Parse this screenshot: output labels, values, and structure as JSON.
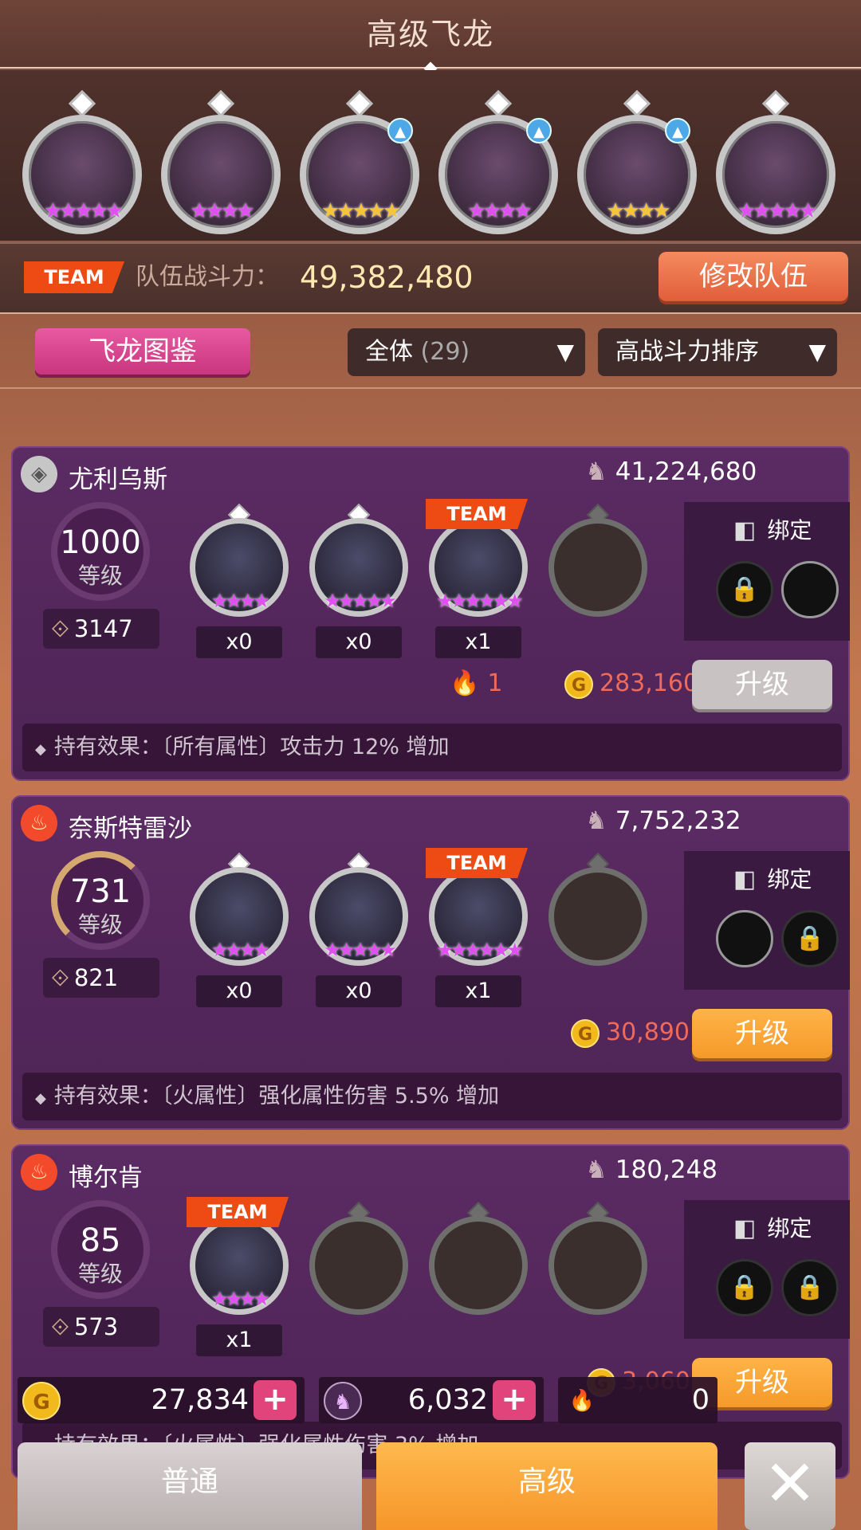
{
  "header": {
    "title": "高级飞龙"
  },
  "team_strip": {
    "slots": [
      {
        "name": "slot-1",
        "stars": "★★★★★",
        "star_color": "purple",
        "upgrade": false
      },
      {
        "name": "slot-2",
        "stars": "★★★★",
        "star_color": "purple",
        "upgrade": false
      },
      {
        "name": "slot-3",
        "stars": "★★★★★",
        "star_color": "gold",
        "upgrade": true
      },
      {
        "name": "slot-4",
        "stars": "★★★★",
        "star_color": "purple",
        "upgrade": true
      },
      {
        "name": "slot-5",
        "stars": "★★★★",
        "star_color": "gold",
        "upgrade": true
      },
      {
        "name": "slot-6",
        "stars": "★★★★★",
        "star_color": "purple",
        "upgrade": false
      }
    ],
    "upgrade_icon": "▲"
  },
  "power_bar": {
    "team_tag": "TEAM",
    "label": "队伍战斗力：",
    "value": "49,382,480",
    "modify_button": "修改队伍"
  },
  "filters": {
    "codex_button": "飞龙图鉴",
    "category": "全体",
    "category_count": "(29)",
    "sort": "高战斗力排序",
    "arrow": "▼"
  },
  "cards": [
    {
      "element": "neutral",
      "element_icon": "◈",
      "name": "尤利乌斯",
      "power": "41,224,680",
      "level": "1000",
      "level_label": "等级",
      "rank": "3147",
      "slots": [
        {
          "count": "x0",
          "stars": "★★★★",
          "team": false,
          "empty": false
        },
        {
          "count": "x0",
          "stars": "★★★★★",
          "team": false,
          "empty": false
        },
        {
          "count": "x1",
          "stars": "★★★★★★",
          "team": true,
          "empty": false
        },
        {
          "count": "",
          "stars": "",
          "team": false,
          "empty": true
        }
      ],
      "team_label": "TEAM",
      "bind_label": "绑定",
      "flame_cost": "1",
      "coin_cost": "283,160",
      "upgrade": "升级",
      "effect": "持有效果：〔所有属性〕攻击力 12% 增加"
    },
    {
      "element": "fire",
      "element_icon": "♨",
      "name": "奈斯特雷沙",
      "power": "7,752,232",
      "level": "731",
      "level_label": "等级",
      "rank": "821",
      "slots": [
        {
          "count": "x0",
          "stars": "★★★★",
          "team": false,
          "empty": false
        },
        {
          "count": "x0",
          "stars": "★★★★★",
          "team": false,
          "empty": false
        },
        {
          "count": "x1",
          "stars": "★★★★★★",
          "team": true,
          "empty": false
        },
        {
          "count": "",
          "stars": "",
          "team": false,
          "empty": true
        }
      ],
      "team_label": "TEAM",
      "bind_label": "绑定",
      "coin_cost": "30,890",
      "upgrade": "升级",
      "effect": "持有效果：〔火属性〕强化属性伤害 5.5% 增加"
    },
    {
      "element": "fire",
      "element_icon": "♨",
      "name": "博尔肯",
      "power": "180,248",
      "level": "85",
      "level_label": "等级",
      "rank": "573",
      "slots": [
        {
          "count": "x1",
          "stars": "★★★★",
          "team": true,
          "empty": false
        },
        {
          "count": "",
          "stars": "",
          "team": false,
          "empty": true
        },
        {
          "count": "",
          "stars": "",
          "team": false,
          "empty": true
        },
        {
          "count": "",
          "stars": "",
          "team": false,
          "empty": true
        }
      ],
      "team_label": "TEAM",
      "bind_label": "绑定",
      "coin_cost": "3,060",
      "upgrade": "升级",
      "effect": "持有效果：〔火属性〕强化属性伤害 3% 增加"
    }
  ],
  "resources": {
    "gold": "27,834",
    "gem": "6,032",
    "flame": "0",
    "plus": "+"
  },
  "bottom_tabs": {
    "normal": "普通",
    "advanced": "高级",
    "close": "✕"
  },
  "icons": {
    "lock": "🔒",
    "bind": "◧",
    "dragon": "♞",
    "rank": "⟐",
    "coin": "G",
    "flame": "🔥"
  }
}
